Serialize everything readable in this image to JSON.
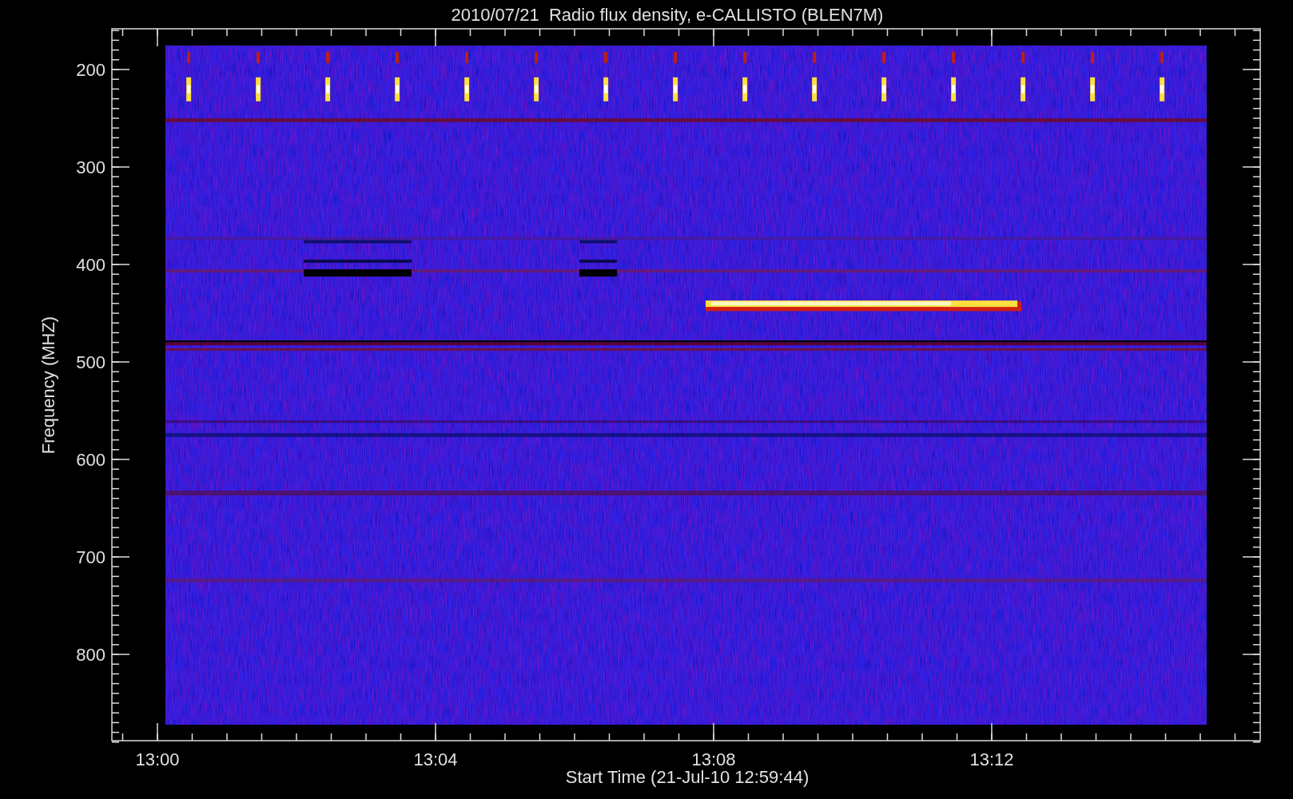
{
  "plot": {
    "title": "2010/07/21  Radio flux density, e-CALLISTO (BLEN7M)",
    "x_axis": {
      "label": "Start Time (21-Jul-10 12:59:44)",
      "ticks": [
        "13:00",
        "13:04",
        "13:08",
        "13:12"
      ]
    },
    "y_axis": {
      "label": "Frequency (MHZ)",
      "ticks": [
        "200",
        "300",
        "400",
        "500",
        "600",
        "700",
        "800"
      ]
    }
  }
}
